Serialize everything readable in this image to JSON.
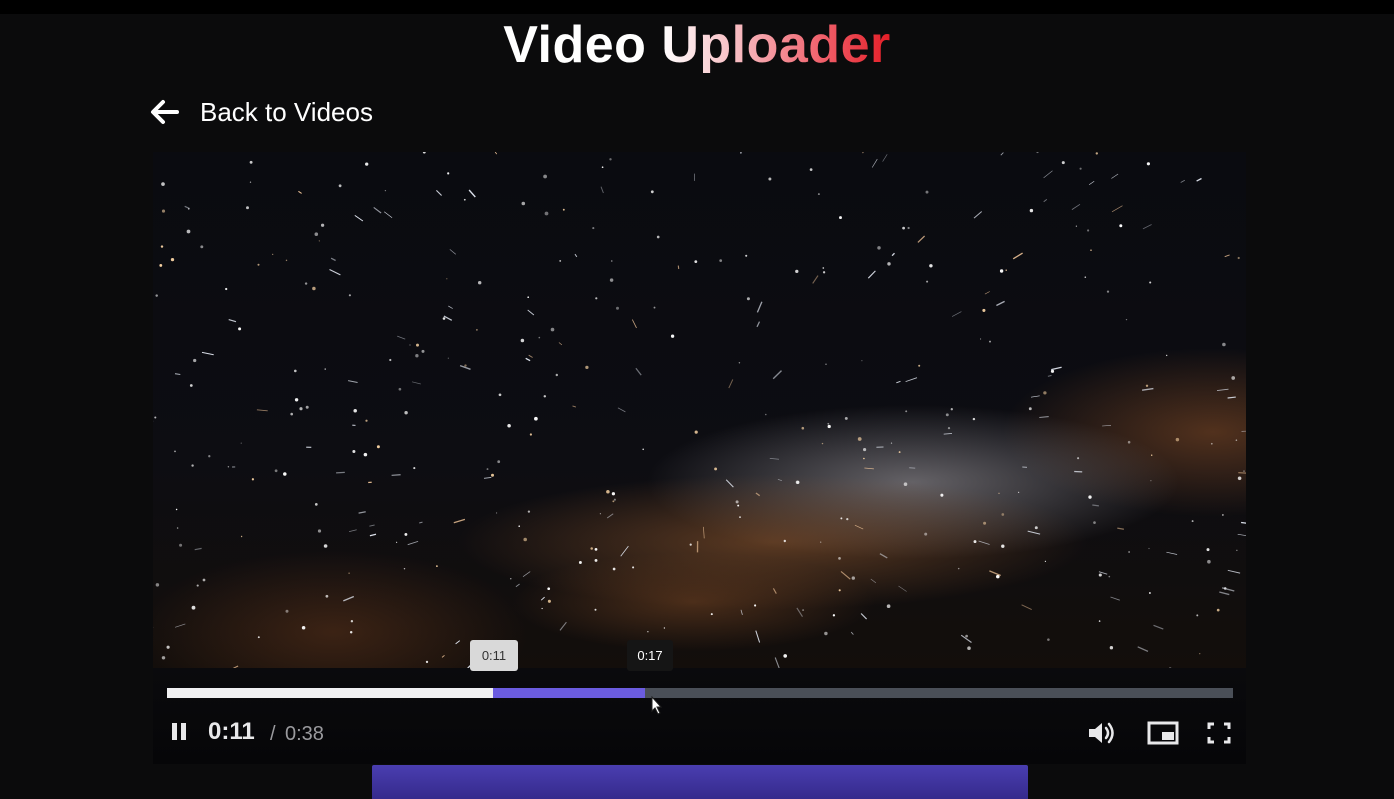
{
  "app": {
    "title_part1": "Video ",
    "title_part2": "Uploader"
  },
  "nav": {
    "back_label": "Back to Videos",
    "back_icon": "arrow-left-icon"
  },
  "player": {
    "current_time": "0:11",
    "separator": "/",
    "duration": "0:38",
    "hover_tooltip": "0:11",
    "seek_tooltip": "0:17",
    "played_fraction": 0.306,
    "hover_fraction": 0.449,
    "state": "playing",
    "icons": {
      "pause": "pause-icon",
      "volume": "volume-icon",
      "pip": "picture-in-picture-icon",
      "fullscreen": "fullscreen-icon"
    }
  },
  "colors": {
    "background": "#0b0b0c",
    "progress_played": "#f0f0f2",
    "progress_hover": "#6b5ce0",
    "progress_track": "#4a4f58",
    "accent_bar": "#4a3eb0",
    "title_gradient_end": "#e41d26"
  }
}
